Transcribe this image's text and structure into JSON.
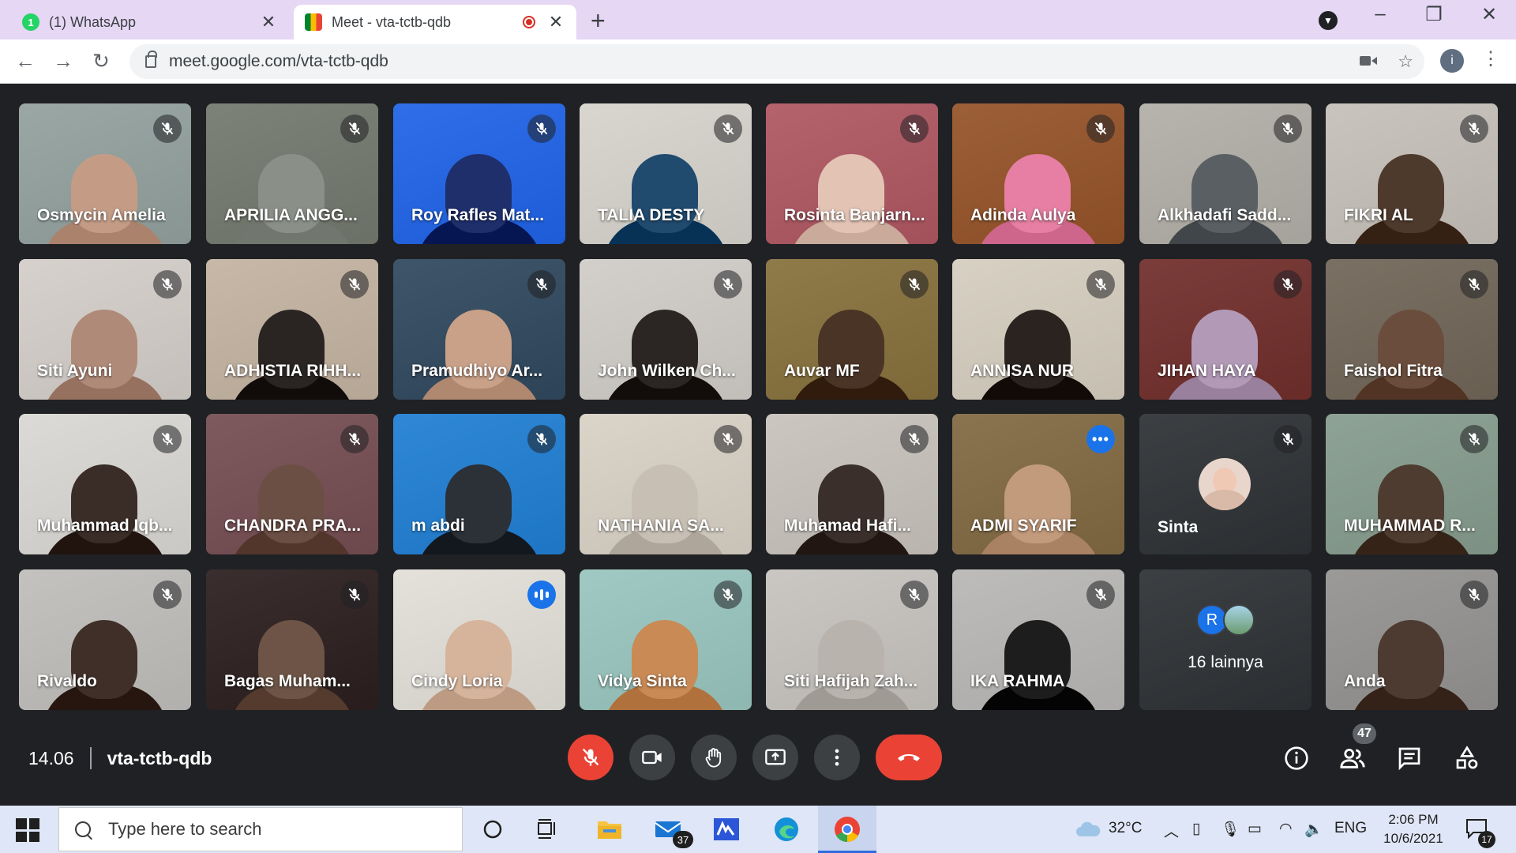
{
  "browser": {
    "tabs": [
      {
        "title": "(1) WhatsApp",
        "badge": "1",
        "active": false
      },
      {
        "title": "Meet - vta-tctb-qdb",
        "active": true
      }
    ],
    "url": "meet.google.com/vta-tctb-qdb",
    "profile_initial": "i"
  },
  "meeting": {
    "time": "14.06",
    "code": "vta-tctb-qdb",
    "participant_count": "47"
  },
  "participants": [
    {
      "name": "Osmycin Amelia",
      "bg": "#9aa7a4",
      "skin": "#c49c86",
      "muted": true
    },
    {
      "name": "APRILIA ANGG...",
      "bg": "#7d8278",
      "skin": "#8a9088",
      "muted": true
    },
    {
      "name": "Roy Rafles Mat...",
      "bg": "#2f6ee8",
      "skin": "#1f2f6c",
      "muted": true
    },
    {
      "name": "TALIA DESTY",
      "bg": "#d9d6cf",
      "skin": "#204a6e",
      "muted": true
    },
    {
      "name": "Rosinta Banjarn...",
      "bg": "#b4626c",
      "skin": "#e3c3b4",
      "muted": true
    },
    {
      "name": "Adinda Aulya",
      "bg": "#9c5f37",
      "skin": "#e67fa3",
      "muted": true
    },
    {
      "name": "Alkhadafi Sadd...",
      "bg": "#b7b4ad",
      "skin": "#5a5f63",
      "muted": true
    },
    {
      "name": "FIKRI AL",
      "bg": "#c9c4bd",
      "skin": "#4e3a2c",
      "muted": true
    },
    {
      "name": "Siti Ayuni",
      "bg": "#d6d1cc",
      "skin": "#b08a78",
      "muted": true
    },
    {
      "name": "ADHISTIA RIHH...",
      "bg": "#c7b8a7",
      "skin": "#2a2523",
      "muted": true
    },
    {
      "name": "Pramudhiyo Ar...",
      "bg": "#3f5569",
      "skin": "#c9a088",
      "muted": true
    },
    {
      "name": "John Wilken Ch...",
      "bg": "#d3d0cb",
      "skin": "#2b2623",
      "muted": true
    },
    {
      "name": "Auvar MF",
      "bg": "#8f7a4a",
      "skin": "#4a3426",
      "muted": true
    },
    {
      "name": "ANNISA NUR",
      "bg": "#d8d1c3",
      "skin": "#2a2320",
      "muted": true
    },
    {
      "name": "JIHAN HAYA",
      "bg": "#7b3d3a",
      "skin": "#b29ab7",
      "muted": true
    },
    {
      "name": "Faishol Fitra",
      "bg": "#7a7063",
      "skin": "#6a4d3c",
      "muted": true
    },
    {
      "name": "Muhammad Iqb...",
      "bg": "#dcdad6",
      "skin": "#3a2d27",
      "muted": true
    },
    {
      "name": "CHANDRA PRA...",
      "bg": "#7e5a5e",
      "skin": "#6b4f45",
      "muted": true
    },
    {
      "name": "m abdi",
      "bg": "#2f87d6",
      "skin": "#2c3037",
      "muted": true
    },
    {
      "name": "NATHANIA SA...",
      "bg": "#dad4c9",
      "skin": "#c7bfb4",
      "muted": true
    },
    {
      "name": "Muhamad Hafi...",
      "bg": "#cbc6c0",
      "skin": "#3a2f2b",
      "muted": true
    },
    {
      "name": "ADMI SYARIF",
      "bg": "#8a7450",
      "skin": "#c29a7c",
      "muted": false,
      "more": true
    },
    {
      "name": "Sinta",
      "bg": "#3c4043",
      "skin": "",
      "muted": true,
      "avatar": true
    },
    {
      "name": "MUHAMMAD R...",
      "bg": "#8ea395",
      "skin": "#4f3c31",
      "muted": true
    },
    {
      "name": "Rivaldo",
      "bg": "#c4c2bf",
      "skin": "#3f2f28",
      "muted": true
    },
    {
      "name": "Bagas Muham...",
      "bg": "#3a2e2e",
      "skin": "#6d5446",
      "muted": true
    },
    {
      "name": "Cindy Loria",
      "bg": "#e4e1da",
      "skin": "#d6b49c",
      "muted": false,
      "speaking": true
    },
    {
      "name": "Vidya Sinta",
      "bg": "#9fc9c2",
      "skin": "#c98a55",
      "muted": true
    },
    {
      "name": "Siti Hafijah Zah...",
      "bg": "#cac7c3",
      "skin": "#b9b3ad",
      "muted": true
    },
    {
      "name": "IKA RAHMA",
      "bg": "#bdbcba",
      "skin": "#1d1d1d",
      "muted": true
    },
    {
      "name": "16 lainnya",
      "bg": "#3c4043",
      "skin": "",
      "muted": false,
      "others": true,
      "initial": "R"
    },
    {
      "name": "Anda",
      "bg": "#9b9a98",
      "skin": "#4d3a30",
      "muted": true
    }
  ],
  "taskbar": {
    "search_placeholder": "Type here to search",
    "temperature": "32°C",
    "language": "ENG",
    "time": "2:06 PM",
    "date": "10/6/2021",
    "mail_badge": "37",
    "notification_badge": "17"
  },
  "colors": {
    "meet_bg": "#202124",
    "tile_bg": "#3c4043",
    "accent_blue": "#1a73e8",
    "danger_red": "#ea4335",
    "tabstrip": "#e6d7f5"
  }
}
